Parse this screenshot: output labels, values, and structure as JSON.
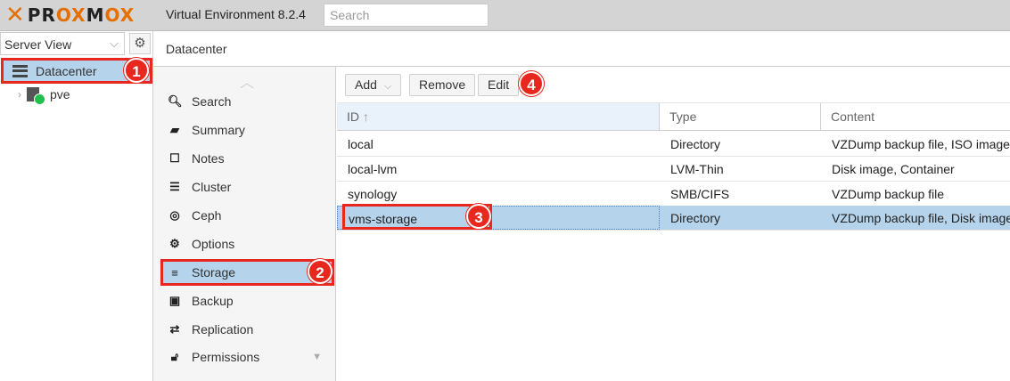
{
  "header": {
    "logo_text": "PROXMOX",
    "version": "Virtual Environment 8.2.4",
    "search_placeholder": "Search"
  },
  "tree": {
    "view_label": "Server View",
    "nodes": [
      {
        "label": "Datacenter",
        "selected": true
      },
      {
        "label": "pve",
        "status": "online"
      }
    ]
  },
  "content": {
    "title": "Datacenter"
  },
  "nav": {
    "items": [
      {
        "label": "Search",
        "icon": "search-icon"
      },
      {
        "label": "Summary",
        "icon": "book-icon"
      },
      {
        "label": "Notes",
        "icon": "notes-icon"
      },
      {
        "label": "Cluster",
        "icon": "cluster-icon"
      },
      {
        "label": "Ceph",
        "icon": "ceph-icon"
      },
      {
        "label": "Options",
        "icon": "gear-icon"
      },
      {
        "label": "Storage",
        "icon": "database-icon",
        "active": true
      },
      {
        "label": "Backup",
        "icon": "floppy-icon"
      },
      {
        "label": "Replication",
        "icon": "retweet-icon"
      },
      {
        "label": "Permissions",
        "icon": "unlock-icon"
      }
    ]
  },
  "toolbar": {
    "add_label": "Add",
    "remove_label": "Remove",
    "edit_label": "Edit"
  },
  "grid": {
    "columns": [
      "ID",
      "Type",
      "Content"
    ],
    "sort_indicator": "↑",
    "rows": [
      {
        "id": "local",
        "type": "Directory",
        "content": "VZDump backup file, ISO image"
      },
      {
        "id": "local-lvm",
        "type": "LVM-Thin",
        "content": "Disk image, Container"
      },
      {
        "id": "synology",
        "type": "SMB/CIFS",
        "content": "VZDump backup file"
      },
      {
        "id": "vms-storage",
        "type": "Directory",
        "content": "VZDump backup file, Disk image",
        "selected": true
      }
    ]
  },
  "annotations": [
    "1",
    "2",
    "3",
    "4"
  ],
  "colors": {
    "accent": "#e57000",
    "selection": "#b5d3ea",
    "annotation": "#e8281f"
  }
}
